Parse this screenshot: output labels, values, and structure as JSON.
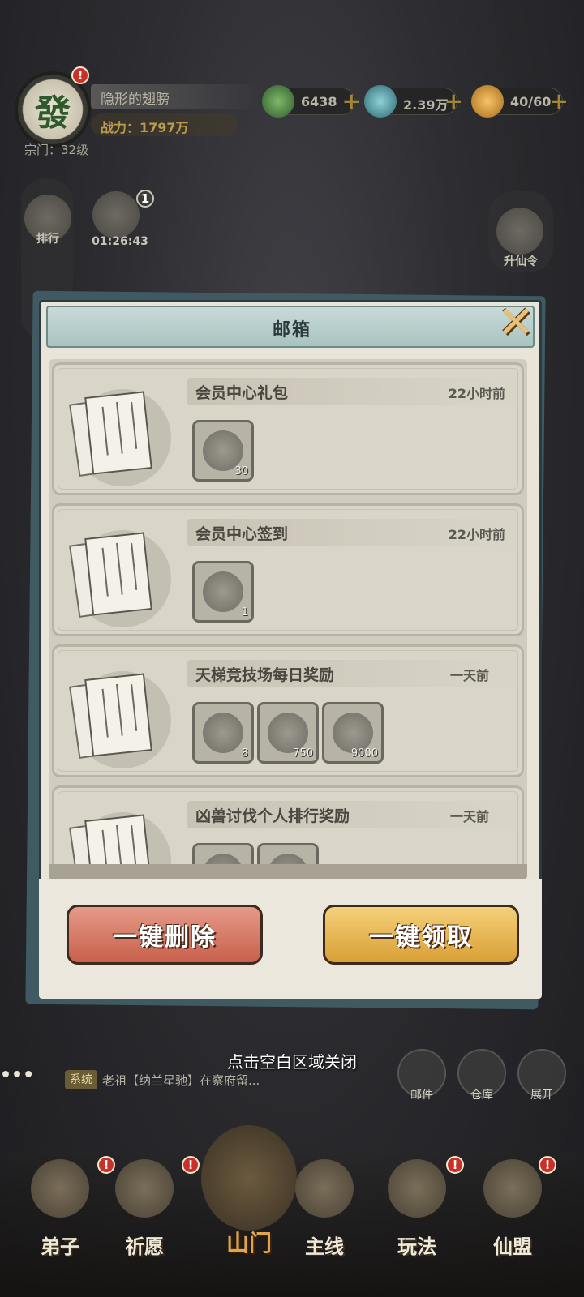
{
  "player": {
    "avatar_char": "發",
    "name": "隐形的翅膀",
    "power": "战力：1797万",
    "sect_level": "宗门：32级",
    "alert": "!"
  },
  "resources": [
    {
      "value": "6438",
      "color": "#4c7a3a"
    },
    {
      "value": "2.39万",
      "color": "#3f7f86"
    },
    {
      "value": "40/60",
      "color": "#c89330"
    }
  ],
  "side": {
    "rank_label": "排行",
    "gift_badge": "1",
    "gift_timer": "01:26:43",
    "ascend_label": "升仙令"
  },
  "mailbox": {
    "title": "邮箱",
    "close_symbol": "✕",
    "mails": [
      {
        "subject": "会员中心礼包",
        "time": "22小时前",
        "items": [
          {
            "qty": "30"
          }
        ]
      },
      {
        "subject": "会员中心签到",
        "time": "22小时前",
        "items": [
          {
            "qty": "1"
          }
        ]
      },
      {
        "subject": "天梯竞技场每日奖励",
        "time": "一天前",
        "items": [
          {
            "qty": "8"
          },
          {
            "qty": "750"
          },
          {
            "qty": "9000"
          }
        ]
      },
      {
        "subject": "凶兽讨伐个人排行奖励",
        "time": "一天前",
        "items": [
          {
            "qty": ""
          },
          {
            "qty": ""
          }
        ]
      }
    ],
    "delete_all": "一键删除",
    "claim_all": "一键领取"
  },
  "hint": "点击空白区域关闭",
  "chat": {
    "tag": "系统",
    "text": "老祖【纳兰星驰】在察府留..."
  },
  "quick_buttons": [
    {
      "label": "邮件"
    },
    {
      "label": "仓库"
    },
    {
      "label": "展开"
    }
  ],
  "nav": [
    {
      "label": "弟子"
    },
    {
      "label": "祈愿"
    },
    {
      "label": "山门"
    },
    {
      "label": "主线"
    },
    {
      "label": "玩法"
    },
    {
      "label": "仙盟"
    }
  ]
}
